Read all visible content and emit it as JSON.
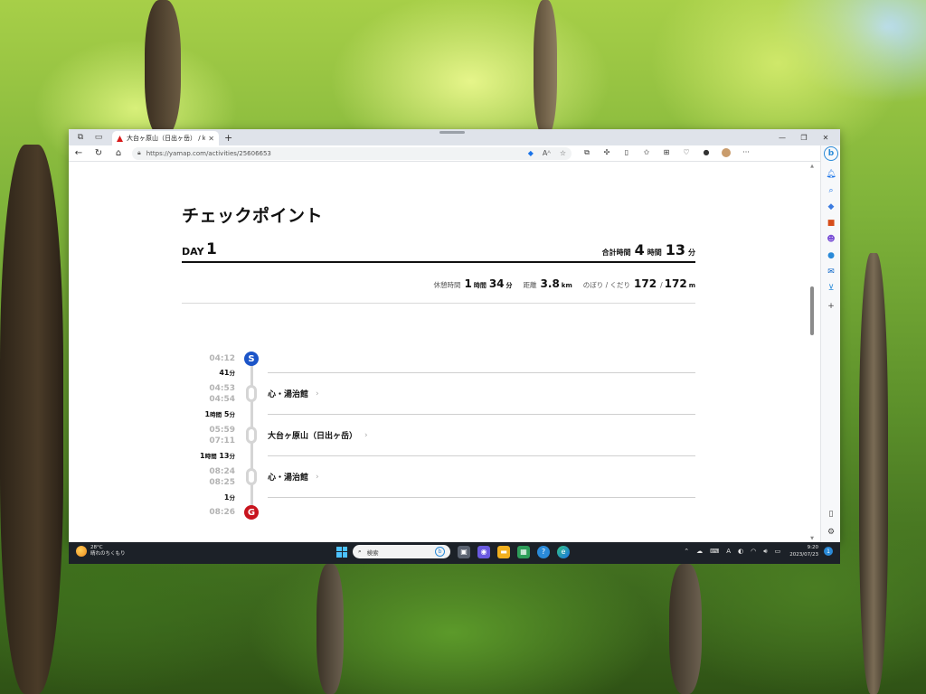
{
  "browser": {
    "tab_title": "大台ヶ原山（日出ヶ岳） / kazuh",
    "tab_close": "✕",
    "new_tab": "+",
    "url": "https://yamap.com/activities/25606653",
    "win_minimize": "—",
    "win_restore": "❐",
    "win_close": "✕"
  },
  "page": {
    "title": "チェックポイント",
    "day_label": "DAY",
    "day_number": "1",
    "total": {
      "label": "合計時間",
      "hours": "4",
      "hours_unit": "時間",
      "minutes": "13",
      "minutes_unit": "分"
    },
    "stats": {
      "rest_label": "休憩時間",
      "rest_hours": "1",
      "rest_hours_unit": "時間",
      "rest_minutes": "34",
      "rest_minutes_unit": "分",
      "distance_label": "距離",
      "distance": "3.8",
      "distance_unit": "km",
      "updown_label": "のぼり / くだり",
      "up": "172",
      "sep": "/",
      "down": "172",
      "updown_unit": "m"
    }
  },
  "timeline": {
    "start_time": "04:12",
    "start_badge": "S",
    "goal_time": "08:26",
    "goal_badge": "G",
    "durations": [
      {
        "h": "",
        "hu": "",
        "m": "41",
        "mu": "分"
      },
      {
        "h": "1",
        "hu": "時間",
        "m": "5",
        "mu": "分"
      },
      {
        "h": "1",
        "hu": "時間",
        "m": "13",
        "mu": "分"
      },
      {
        "h": "",
        "hu": "",
        "m": "1",
        "mu": "分"
      }
    ],
    "checkpoints": [
      {
        "arrive": "04:53",
        "depart": "04:54",
        "name": "心・湯治館"
      },
      {
        "arrive": "05:59",
        "depart": "07:11",
        "name": "大台ヶ原山（日出ヶ岳）"
      },
      {
        "arrive": "08:24",
        "depart": "08:25",
        "name": "心・湯治館"
      }
    ],
    "chevron": "›"
  },
  "taskbar": {
    "temp": "28°C",
    "weather": "晴れのちくもり",
    "search_placeholder": "検索",
    "time": "9:20",
    "date": "2023/07/23",
    "notification_count": "1"
  }
}
